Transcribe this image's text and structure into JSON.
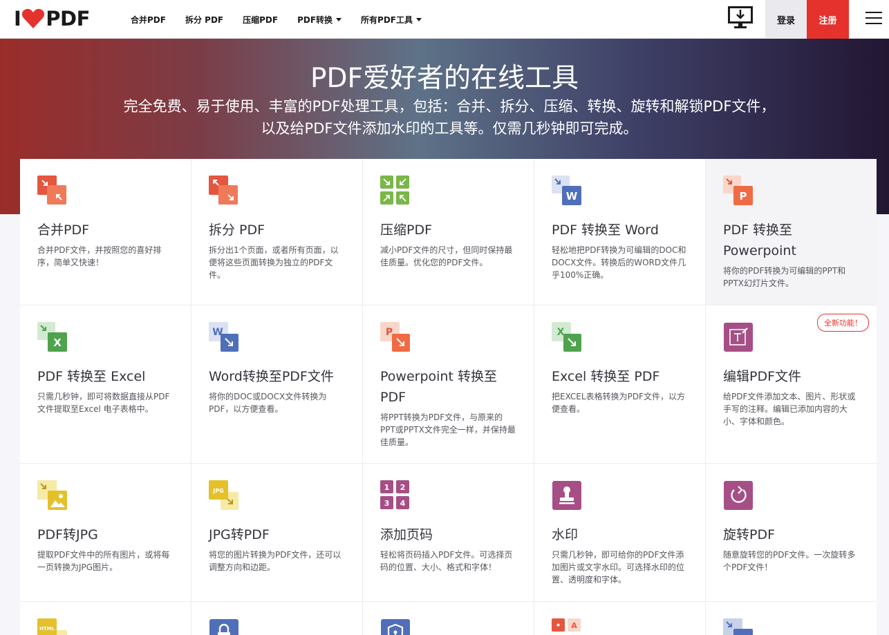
{
  "header": {
    "logo_left": "I",
    "logo_right": "PDF",
    "nav": [
      {
        "label": "合并PDF",
        "dropdown": false
      },
      {
        "label": "拆分 PDF",
        "dropdown": false
      },
      {
        "label": "压缩PDF",
        "dropdown": false
      },
      {
        "label": "PDF转换",
        "dropdown": true
      },
      {
        "label": "所有PDF工具",
        "dropdown": true
      }
    ],
    "login": "登录",
    "signup": "注册"
  },
  "hero": {
    "title": "PDF爱好者的在线工具",
    "subtitle": "完全免费、易于使用、丰富的PDF处理工具，包括：合并、拆分、压缩、转换、旋转和解锁PDF文件，以及给PDF文件添加水印的工具等。仅需几秒钟即可完成。"
  },
  "tools": [
    {
      "title": "合并PDF",
      "desc": "合并PDF文件，并按照您的喜好排序，简单又快速！",
      "icon": "merge-icon"
    },
    {
      "title": "拆分 PDF",
      "desc": "拆分出1个页面，或者所有页面，以便将这些页面转换为独立的PDF文件。",
      "icon": "split-icon"
    },
    {
      "title": "压缩PDF",
      "desc": "减小PDF文件的尺寸，但同时保持最佳质量。优化您的PDF文件。",
      "icon": "compress-icon"
    },
    {
      "title": "PDF 转换至 Word",
      "desc": "轻松地把PDF转换为可编辑的DOC和DOCX文件。转换后的WORD文件几乎100%正确。",
      "icon": "pdf-to-word-icon"
    },
    {
      "title": "PDF 转换至 Powerpoint",
      "desc": "将你的PDF转换为可编辑的PPT和PPTX幻灯片文件。",
      "icon": "pdf-to-powerpoint-icon"
    },
    {
      "title": "PDF 转换至 Excel",
      "desc": "只需几秒钟，即可将数据直接从PDF文件提取至Excel 电子表格中。",
      "icon": "pdf-to-excel-icon"
    },
    {
      "title": "Word转换至PDF文件",
      "desc": "将你的DOC或DOCX文件转换为PDF，以方便查看。",
      "icon": "word-to-pdf-icon"
    },
    {
      "title": "Powerpoint 转换至 PDF",
      "desc": "将PPT转换为PDF文件，与原来的PPT或PPTX文件完全一样，并保持最佳质量。",
      "icon": "powerpoint-to-pdf-icon"
    },
    {
      "title": "Excel 转换至 PDF",
      "desc": "把EXCEL表格转换为PDF文件，以方便查看。",
      "icon": "excel-to-pdf-icon"
    },
    {
      "title": "编辑PDF文件",
      "desc": "给PDF文件添加文本、图片、形状或手写的注释。编辑已添加内容的大小、字体和颜色。",
      "icon": "edit-pdf-icon",
      "badge": "全新功能！"
    },
    {
      "title": "PDF转JPG",
      "desc": "提取PDF文件中的所有图片，或将每一页转换为JPG图片。",
      "icon": "pdf-to-jpg-icon"
    },
    {
      "title": "JPG转PDF",
      "desc": "将您的图片转换为PDF文件，还可以调整方向和边距。",
      "icon": "jpg-to-pdf-icon"
    },
    {
      "title": "添加页码",
      "desc": "轻松将页码插入PDF文件。可选择页码的位置、大小、格式和字体！",
      "icon": "page-numbers-icon"
    },
    {
      "title": "水印",
      "desc": "只需几秒钟，即可给你的PDF文件添加图片或文字水印。可选择水印的位置、透明度和字体。",
      "icon": "watermark-icon"
    },
    {
      "title": "旋转PDF",
      "desc": "随意旋转您的PDF文件。一次旋转多个PDF文件！",
      "icon": "rotate-icon"
    }
  ],
  "icon_labels": {
    "word": "W",
    "excel": "X",
    "powerpoint": "P",
    "jpg": "JPG",
    "html": "HTML",
    "num1": "1",
    "num2": "2",
    "num3": "3",
    "num4": "4",
    "letter_a": "A"
  },
  "colors": {
    "brand_red": "#e5322d",
    "orange_red": "#e5563f",
    "word_blue": "#4f6fb8",
    "excel_green": "#4fa34d",
    "compress_green": "#7ab648",
    "purple": "#a64e86",
    "yellow": "#e4c12b"
  }
}
